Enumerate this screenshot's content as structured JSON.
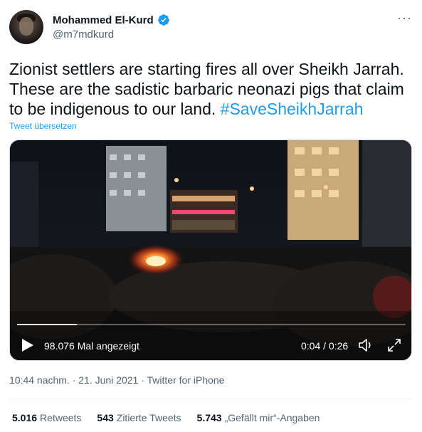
{
  "author": {
    "name": "Mohammed El-Kurd",
    "handle": "@m7mdkurd",
    "verified": true
  },
  "tweet": {
    "text_main": "Zionist settlers are starting fires all over Sheikh Jarrah. These are the sadistic barbaric neonazi pigs that claim to be indigenous to our land. ",
    "hashtag": "#SaveSheikhJarrah",
    "translate_label": "Tweet übersetzen"
  },
  "video": {
    "views": "98.076 Mal angezeigt",
    "time": "0:04 / 0:26",
    "progress_fraction": 0.154
  },
  "meta": {
    "timestamp": "10:44 nachm. · 21. Juni 2021 · Twitter for iPhone"
  },
  "stats": {
    "retweets_count": "5.016",
    "retweets_label": "Retweets",
    "quotes_count": "543",
    "quotes_label": "Zitierte Tweets",
    "likes_count": "5.743",
    "likes_label": "„Gefällt mir“-Angaben"
  },
  "icons": {
    "more": "more-icon",
    "verified": "verified-badge-icon",
    "play": "play-icon",
    "volume": "volume-icon",
    "expand": "fullscreen-icon"
  },
  "colors": {
    "accent": "#1d9bf0",
    "secondary_text": "#536471",
    "primary_text": "#0f1419"
  }
}
